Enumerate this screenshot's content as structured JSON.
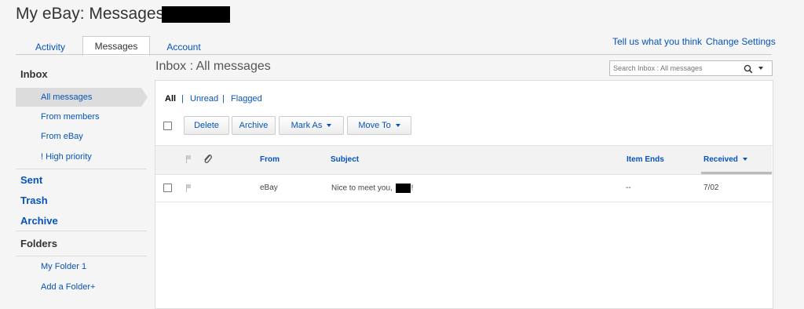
{
  "header": {
    "title": "My eBay: Messages"
  },
  "tabs": [
    {
      "label": "Activity"
    },
    {
      "label": "Messages"
    },
    {
      "label": "Account"
    }
  ],
  "top_links": {
    "feedback": "Tell us what you think",
    "settings": "Change Settings"
  },
  "sidebar": {
    "inbox": "Inbox",
    "inbox_items": [
      "All messages",
      "From members",
      "From eBay",
      "! High priority"
    ],
    "sent": "Sent",
    "trash": "Trash",
    "archive": "Archive",
    "folders": "Folders",
    "folder_items": [
      "My Folder 1",
      "Add a Folder+"
    ]
  },
  "main": {
    "title": "Inbox : All messages",
    "search_placeholder": "Search Inbox : All messages",
    "filters": [
      "All",
      "Unread",
      "Flagged"
    ],
    "filter_sep": "|",
    "buttons": {
      "delete": "Delete",
      "archive": "Archive",
      "mark_as": "Mark As",
      "move_to": "Move To"
    },
    "columns": {
      "from": "From",
      "subject": "Subject",
      "item_ends": "Item Ends",
      "received": "Received"
    },
    "rows": [
      {
        "from": "eBay",
        "subject_prefix": "Nice to meet you,",
        "subject_suffix": "!",
        "item_ends": "--",
        "received": "7/02"
      }
    ]
  },
  "icons": [
    "search-icon",
    "chevron-down-icon",
    "flag-icon",
    "paperclip-icon",
    "sort-desc-icon"
  ]
}
